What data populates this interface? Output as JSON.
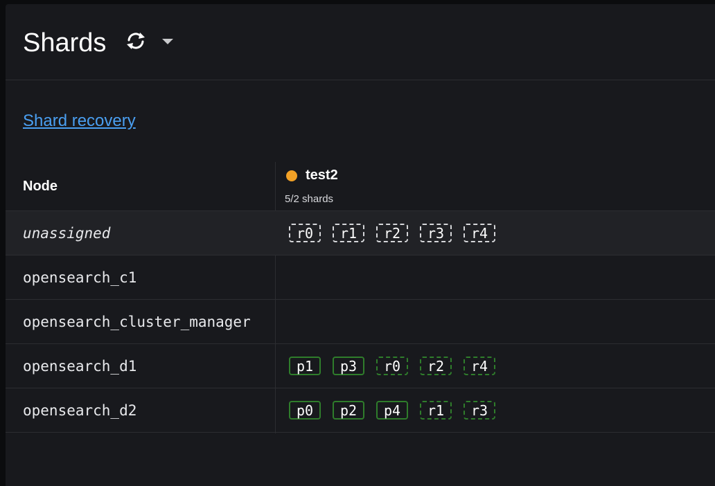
{
  "page": {
    "title": "Shards"
  },
  "links": {
    "shard_recovery": "Shard recovery"
  },
  "table": {
    "node_header": "Node",
    "index": {
      "name": "test2",
      "shard_count": "5/2 shards",
      "status_color": "#f2a126"
    },
    "rows": [
      {
        "node": "unassigned",
        "italic": true,
        "alt": true,
        "shards": [
          {
            "label": "r0",
            "kind": "unassigned"
          },
          {
            "label": "r1",
            "kind": "unassigned"
          },
          {
            "label": "r2",
            "kind": "unassigned"
          },
          {
            "label": "r3",
            "kind": "unassigned"
          },
          {
            "label": "r4",
            "kind": "unassigned"
          }
        ]
      },
      {
        "node": "opensearch_c1",
        "italic": false,
        "alt": false,
        "shards": []
      },
      {
        "node": "opensearch_cluster_manager",
        "italic": false,
        "alt": false,
        "shards": []
      },
      {
        "node": "opensearch_d1",
        "italic": false,
        "alt": false,
        "shards": [
          {
            "label": "p1",
            "kind": "primary"
          },
          {
            "label": "p3",
            "kind": "primary"
          },
          {
            "label": "r0",
            "kind": "replica"
          },
          {
            "label": "r2",
            "kind": "replica"
          },
          {
            "label": "r4",
            "kind": "replica"
          }
        ]
      },
      {
        "node": "opensearch_d2",
        "italic": false,
        "alt": false,
        "shards": [
          {
            "label": "p0",
            "kind": "primary"
          },
          {
            "label": "p2",
            "kind": "primary"
          },
          {
            "label": "p4",
            "kind": "primary"
          },
          {
            "label": "r1",
            "kind": "replica"
          },
          {
            "label": "r3",
            "kind": "replica"
          }
        ]
      }
    ]
  },
  "icons": {
    "refresh": "refresh-icon",
    "dropdown": "caret-down-icon"
  },
  "colors": {
    "link": "#4a9ff1",
    "primary_border": "#2f7d2b",
    "unassigned_border": "#d6d7da",
    "status_yellow": "#f2a126"
  }
}
